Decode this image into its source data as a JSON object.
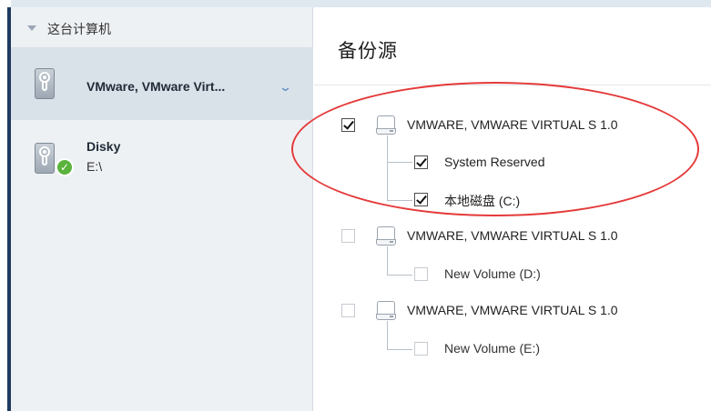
{
  "sidebar": {
    "header": "这台计算机",
    "items": [
      {
        "title": "VMware, VMware Virt...",
        "subtitle": "",
        "selected": true,
        "icon": "hard-drive-icon"
      },
      {
        "title": "Disky",
        "subtitle": "E:\\",
        "selected": false,
        "icon": "hard-drive-icon",
        "badge": "check-icon"
      }
    ]
  },
  "main": {
    "title": "备份源",
    "disks": [
      {
        "label": "VMWARE, VMWARE VIRTUAL S 1.0",
        "checked": true,
        "volumes": [
          {
            "label": "System Reserved",
            "checked": true
          },
          {
            "label": "本地磁盘 (C:)",
            "checked": true
          }
        ]
      },
      {
        "label": "VMWARE, VMWARE VIRTUAL S 1.0",
        "checked": false,
        "volumes": [
          {
            "label": "New Volume (D:)",
            "checked": false
          }
        ]
      },
      {
        "label": "VMWARE, VMWARE VIRTUAL S 1.0",
        "checked": false,
        "volumes": [
          {
            "label": "New Volume (E:)",
            "checked": false
          }
        ]
      }
    ]
  },
  "colors": {
    "sidebar_bg": "#eef1f4",
    "selected_bg": "#d9e1e9",
    "accent_blue": "#4f87c3",
    "annotation_red": "#e53a3a",
    "badge_green": "#5ab33a"
  }
}
